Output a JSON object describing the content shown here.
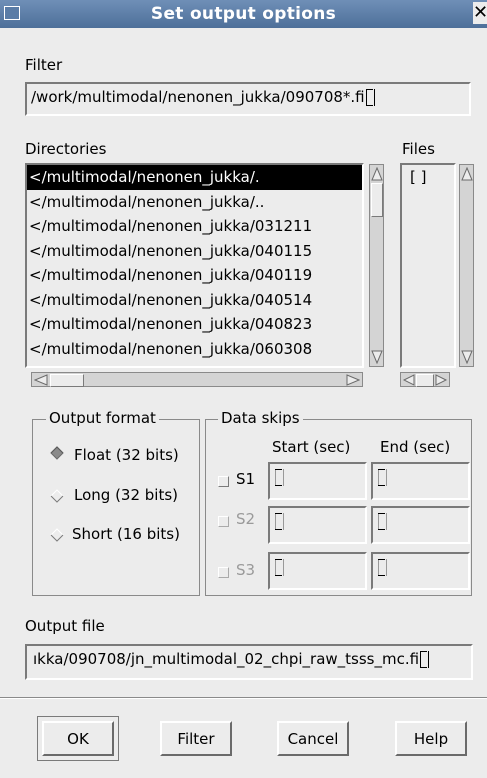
{
  "window": {
    "title": "Set output options",
    "close_glyph": "✕"
  },
  "filter": {
    "label": "Filter",
    "value": "/work/multimodal/nenonen_jukka/090708*.fi"
  },
  "directories": {
    "label": "Directories",
    "items": [
      "</multimodal/nenonen_jukka/.",
      "</multimodal/nenonen_jukka/..",
      "</multimodal/nenonen_jukka/031211",
      "</multimodal/nenonen_jukka/040115",
      "</multimodal/nenonen_jukka/040119",
      "</multimodal/nenonen_jukka/040514",
      "</multimodal/nenonen_jukka/040823",
      "</multimodal/nenonen_jukka/060308"
    ],
    "selected_index": 0
  },
  "files": {
    "label": "Files",
    "items": [
      "[ ]"
    ]
  },
  "output_format": {
    "title": "Output format",
    "options": [
      "Float (32 bits)",
      "Long (32 bits)",
      "Short (16 bits)"
    ],
    "selected_index": 0
  },
  "data_skips": {
    "title": "Data skips",
    "start_header": "Start (sec)",
    "end_header": "End (sec)",
    "rows": [
      {
        "label": "S1",
        "enabled": true
      },
      {
        "label": "S2",
        "enabled": false
      },
      {
        "label": "S3",
        "enabled": false
      }
    ]
  },
  "output_file": {
    "label": "Output file",
    "value": "ıkka/090708/jn_multimodal_02_chpi_raw_tsss_mc.fi"
  },
  "buttons": {
    "ok": "OK",
    "filter": "Filter",
    "cancel": "Cancel",
    "help": "Help"
  }
}
